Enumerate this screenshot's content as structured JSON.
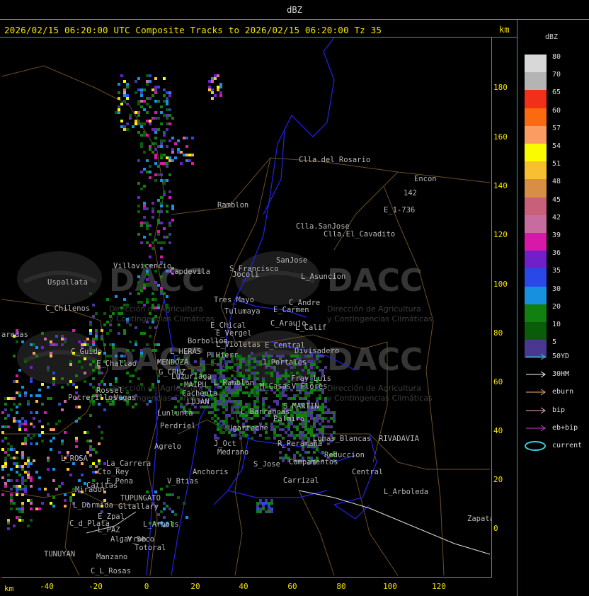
{
  "window": {
    "title": "dBZ"
  },
  "header": {
    "title": "2026/02/15 06:20:00 UTC Composite Tracks to 2026/02/15 06:20:00 Tz 35",
    "km_label": "km"
  },
  "axes": {
    "x_unit": "km",
    "x_ticks": [
      "-40",
      "-20",
      "0",
      "20",
      "40",
      "60",
      "80",
      "100",
      "120"
    ],
    "y_ticks": [
      "180",
      "160",
      "140",
      "120",
      "100",
      "80",
      "60",
      "40",
      "20",
      "0"
    ]
  },
  "legend": {
    "unit": "dBZ",
    "scale": [
      {
        "label": "80",
        "color": "#d8d8d8"
      },
      {
        "label": "70",
        "color": "#b4b4b4"
      },
      {
        "label": "65",
        "color": "#f03018"
      },
      {
        "label": "60",
        "color": "#fb6a10"
      },
      {
        "label": "57",
        "color": "#fb9c62"
      },
      {
        "label": "54",
        "color": "#fbfb00"
      },
      {
        "label": "51",
        "color": "#f8c030"
      },
      {
        "label": "48",
        "color": "#d88e44"
      },
      {
        "label": "45",
        "color": "#c8607c"
      },
      {
        "label": "42",
        "color": "#c86ca0"
      },
      {
        "label": "39",
        "color": "#d818a8"
      },
      {
        "label": "36",
        "color": "#7020c8"
      },
      {
        "label": "35",
        "color": "#2848e8"
      },
      {
        "label": "30",
        "color": "#1890e0"
      },
      {
        "label": "20",
        "color": "#108010"
      },
      {
        "label": "10",
        "color": "#0a5c0a"
      },
      {
        "label": "5",
        "color": "#4a3890"
      }
    ],
    "tracks": [
      {
        "label": "50YD",
        "color": "#30c8d0"
      },
      {
        "label": "30HM",
        "color": "#ffffff"
      },
      {
        "label": "eburn",
        "color": "#f0b070"
      },
      {
        "label": "bip",
        "color": "#f0b0d0"
      },
      {
        "label": "eb+bip",
        "color": "#d040d0"
      },
      {
        "label": "current",
        "color": "#30d0e0"
      }
    ]
  },
  "watermark": {
    "brand": "DACC",
    "line1": "Dirección de Agricultura",
    "line2": "y Contingencias Climáticas"
  },
  "places": [
    "Clla.del_Rosario",
    "Encon",
    "142",
    "E_1-736",
    "Ramblon",
    "Clla.SanJose",
    "Clla.El_Cavadito",
    "Villavicencio",
    "Capdevila",
    "S_Francisco",
    "SanJose",
    "L_Asuncion",
    "Uspallata",
    "Jocoli",
    "Tres_Mayo",
    "C_Andre",
    "E_Carmen",
    "C_Chilenos",
    "Tulumaya",
    "C_Araujo",
    "L_Calif",
    "E_Chical",
    "E_Vergel",
    "aredas",
    "Borbollon",
    "L_Violetas",
    "E_Central",
    "Divisadero",
    "C_Guido",
    "L_HERAS",
    "P_Hierr",
    "MENDOZA",
    "J_Portales",
    "E_Challao",
    "G_CRUZ",
    "Luzuriaga",
    "L_Ramblon",
    "MAIPU",
    "Rossel",
    "Potrerillos",
    "L_Vegas",
    "Cacheuta",
    "LUJAN",
    "Lunlunta",
    "Perdriel",
    "Agrelo",
    "Ugarteche",
    "R_Peramana",
    "RIVADAVIA",
    "Lomas_Blancas",
    "J_Oct",
    "Medrano",
    "Reduccion",
    "L_ROSA",
    "La_Carrera",
    "Cto_Rey",
    "S_Jose",
    "Campamentos",
    "Central",
    "Catitas",
    "E_Pena",
    "V_Btias",
    "Anchoris",
    "Carrizal",
    "Mirador",
    "TUPUNGATO",
    "L_Arboleda",
    "L_Dormida",
    "Gltallary",
    "E_Zpal",
    "C_d_Plata",
    "L_Arbols",
    "Zapata",
    "L_PAZ",
    "Algarrob",
    "V_Seco",
    "Totoral",
    "TUNUYAN",
    "Manzano",
    "C_L_Rosas",
    "V_Flores",
    "M_Casas",
    "L_Barrancas",
    "S_MARTIN",
    "Palmira",
    "Fray_Luis",
    "Montecaseros",
    "L_Cumbre"
  ]
}
